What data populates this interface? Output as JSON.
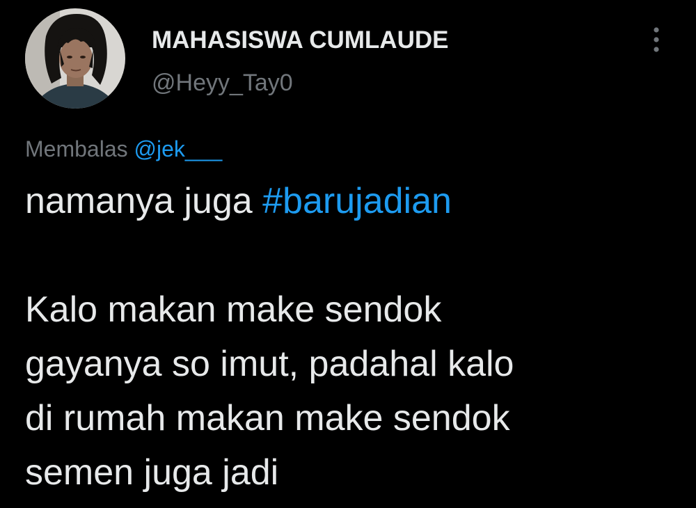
{
  "author": {
    "display_name": "MAHASISWA CUMLAUDE",
    "handle": "@Heyy_Tay0"
  },
  "more_menu_icon": "vertical-ellipsis-icon",
  "reply": {
    "prefix": "Membalas",
    "mention": "@jek___"
  },
  "tweet": {
    "line1_text": "namanya juga ",
    "hashtag": "#barujadian",
    "paragraph2": [
      "Kalo makan make sendok",
      "gayanya so imut, padahal kalo",
      "di rumah makan make sendok",
      "semen juga jadi"
    ]
  },
  "colors": {
    "background": "#000000",
    "primary_text": "#e7e9ea",
    "secondary_text": "#71767b",
    "accent": "#1d9bf0"
  }
}
